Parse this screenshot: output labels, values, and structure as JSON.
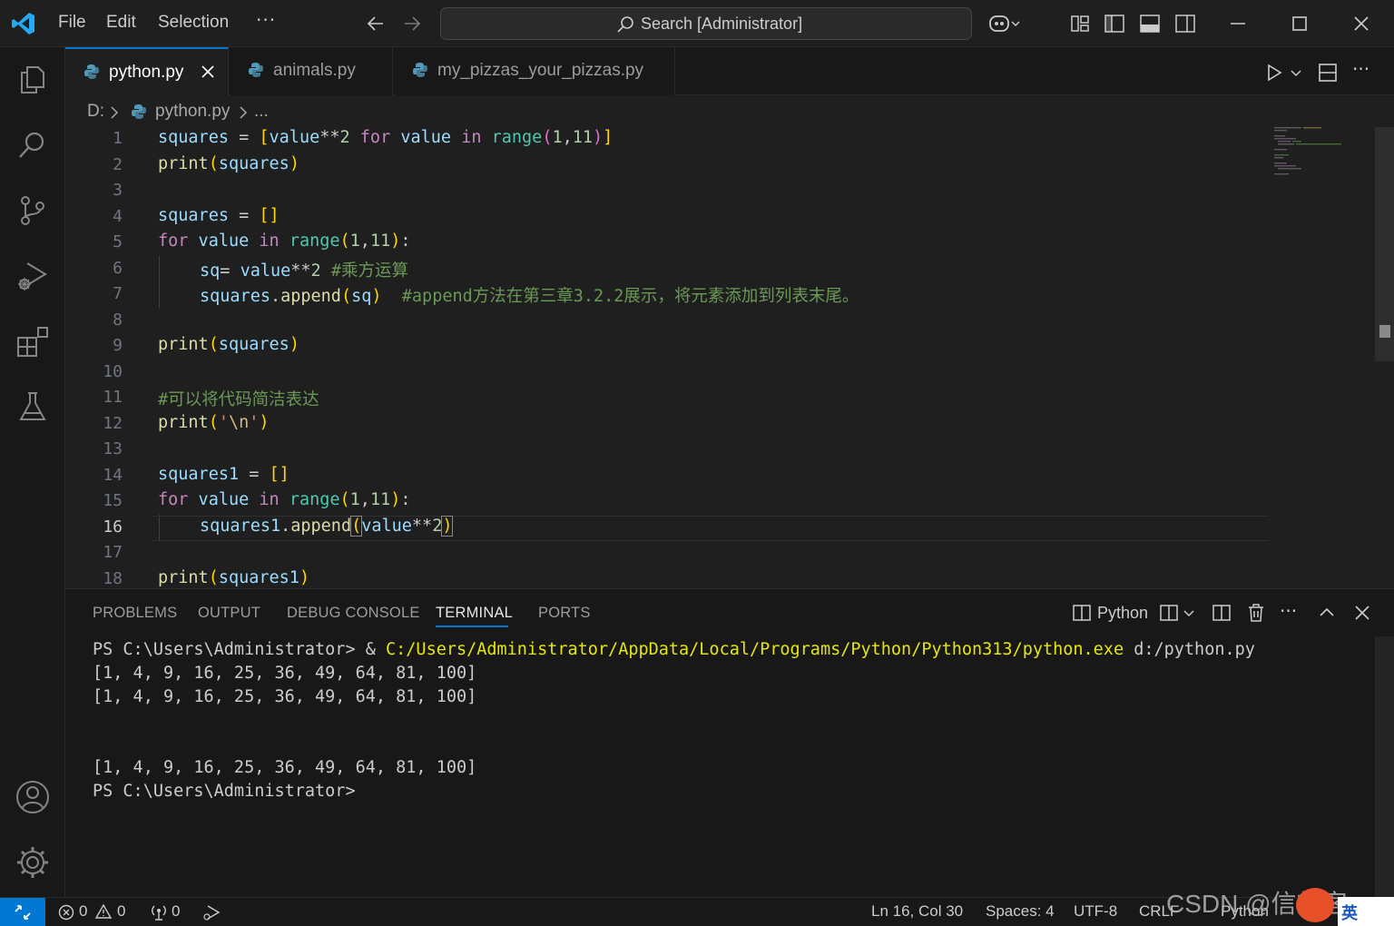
{
  "title_bar": {
    "menu": [
      "File",
      "Edit",
      "Selection"
    ],
    "more": "···",
    "search": "Search [Administrator]"
  },
  "tabs": [
    {
      "label": "python.py",
      "active": true
    },
    {
      "label": "animals.py",
      "active": false
    },
    {
      "label": "my_pizzas_your_pizzas.py",
      "active": false
    }
  ],
  "breadcrumb": {
    "drive": "D:",
    "file": "python.py",
    "more": "..."
  },
  "editor": {
    "line_numbers": [
      "1",
      "2",
      "3",
      "4",
      "5",
      "6",
      "7",
      "8",
      "9",
      "10",
      "11",
      "12",
      "13",
      "14",
      "15",
      "16",
      "17",
      "18"
    ],
    "current_line": "16",
    "text": {
      "l1_a": "squares",
      "l1_b": " = ",
      "l1_c": "[",
      "l1_d": "value",
      "l1_e": "**",
      "l1_f": "2",
      "l1_g": " for ",
      "l1_h": "value",
      "l1_i": " in ",
      "l1_j": "range",
      "l1_k": "(",
      "l1_l": "1",
      "l1_m": ",",
      "l1_n": "11",
      "l1_o": ")",
      "l1_p": "]",
      "l2_a": "print",
      "l2_b": "(",
      "l2_c": "squares",
      "l2_d": ")",
      "l4_a": "squares",
      "l4_b": " = ",
      "l4_c": "[]",
      "l5_a": "for",
      "l5_b": " value ",
      "l5_c": "in",
      "l5_d": " ",
      "l5_e": "range",
      "l5_f": "(",
      "l5_g": "1",
      "l5_h": ",",
      "l5_i": "11",
      "l5_j": ")",
      "l5_k": ":",
      "l6_a": "sq",
      "l6_b": "= ",
      "l6_c": "value",
      "l6_d": "**",
      "l6_e": "2",
      "l6_f": " #乘方运算",
      "l7_a": "squares",
      "l7_b": ".",
      "l7_c": "append",
      "l7_d": "(",
      "l7_e": "sq",
      "l7_f": ")",
      "l7_g": "  #append方法在第三章3.2.2展示，将元素添加到列表末尾。",
      "l9_a": "print",
      "l9_b": "(",
      "l9_c": "squares",
      "l9_d": ")",
      "l11_a": "#可以将代码简洁表达",
      "l12_a": "print",
      "l12_b": "(",
      "l12_c": "'",
      "l12_d": "\\n",
      "l12_e": "'",
      "l12_f": ")",
      "l14_a": "squares1",
      "l14_b": " = ",
      "l14_c": "[]",
      "l15_a": "for",
      "l15_b": " value ",
      "l15_c": "in",
      "l15_d": " ",
      "l15_e": "range",
      "l15_f": "(",
      "l15_g": "1",
      "l15_h": ",",
      "l15_i": "11",
      "l15_j": ")",
      "l15_k": ":",
      "l16_a": "squares1",
      "l16_b": ".",
      "l16_c": "append",
      "l16_d": "(",
      "l16_e": "value",
      "l16_f": "**",
      "l16_g": "2",
      "l16_h": ")",
      "l18_a": "print",
      "l18_b": "(",
      "l18_c": "squares1",
      "l18_d": ")"
    }
  },
  "panel": {
    "tabs": [
      "PROBLEMS",
      "OUTPUT",
      "DEBUG CONSOLE",
      "TERMINAL",
      "PORTS"
    ],
    "active_tab": "TERMINAL",
    "shell_label": "Python",
    "terminal": {
      "line1_prompt": "PS C:\\Users\\Administrator> & ",
      "line1_exe": "C:/Users/Administrator/AppData/Local/Programs/Python/Python313/python.exe",
      "line1_arg": " d:/python.py",
      "line2": "[1, 4, 9, 16, 25, 36, 49, 64, 81, 100]",
      "line3": "[1, 4, 9, 16, 25, 36, 49, 64, 81, 100]",
      "line4": "[1, 4, 9, 16, 25, 36, 49, 64, 81, 100]",
      "line5": "PS C:\\Users\\Administrator>"
    }
  },
  "status_bar": {
    "errors": "0",
    "warnings": "0",
    "ports": "0",
    "position": "Ln 16, Col 30",
    "spaces": "Spaces: 4",
    "encoding": "UTF-8",
    "eol": "CRLF",
    "language": "Python"
  },
  "watermark": {
    "text": "CSDN @信想客sc",
    "ime": "英"
  },
  "colors": {
    "accent": "#0078d4",
    "background": "#1f1f1f",
    "sidebar": "#181818"
  }
}
